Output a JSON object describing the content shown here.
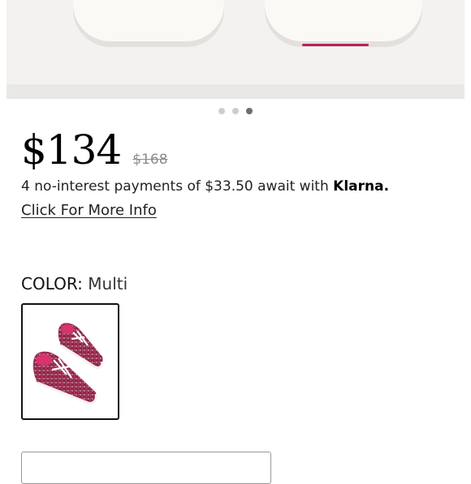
{
  "gallery": {
    "image_count": 3,
    "active_index": 2
  },
  "pricing": {
    "price": "$134",
    "original_price": "$168"
  },
  "klarna": {
    "text": "4 no-interest payments of $33.50 await with ",
    "brand": "Klarna.",
    "more_info_link": "Click For More Info"
  },
  "color": {
    "label": "COLOR:",
    "selected": "Multi"
  },
  "colors": {
    "sneaker_glitter": "#8e2747",
    "sneaker_accent": "#d8336f",
    "price_text": "#000000",
    "strikethrough": "#8c8c8c"
  }
}
